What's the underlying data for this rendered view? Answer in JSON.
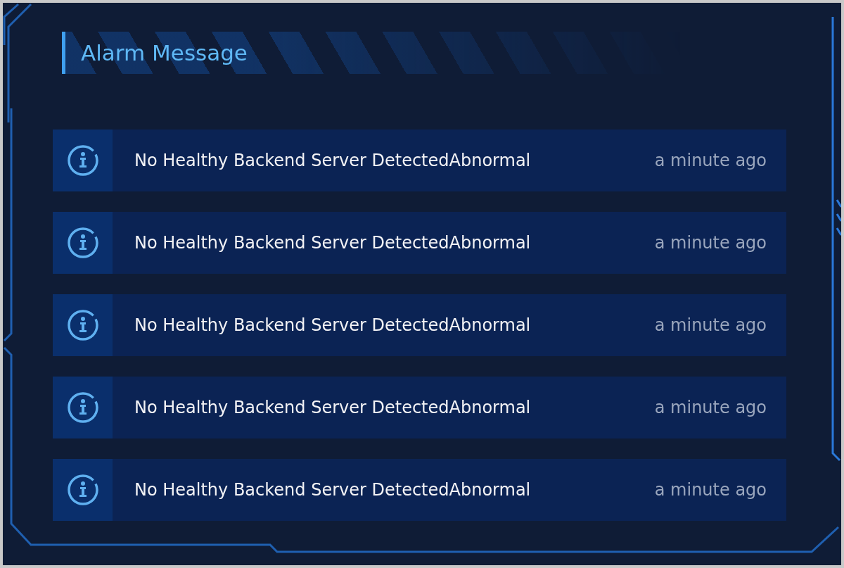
{
  "panel": {
    "title": "Alarm Message"
  },
  "alarms": [
    {
      "message": "No Healthy Backend Server DetectedAbnormal",
      "time": "a minute ago"
    },
    {
      "message": "No Healthy Backend Server DetectedAbnormal",
      "time": "a minute ago"
    },
    {
      "message": "No Healthy Backend Server DetectedAbnormal",
      "time": "a minute ago"
    },
    {
      "message": "No Healthy Backend Server DetectedAbnormal",
      "time": "a minute ago"
    },
    {
      "message": "No Healthy Backend Server DetectedAbnormal",
      "time": "a minute ago"
    }
  ]
}
